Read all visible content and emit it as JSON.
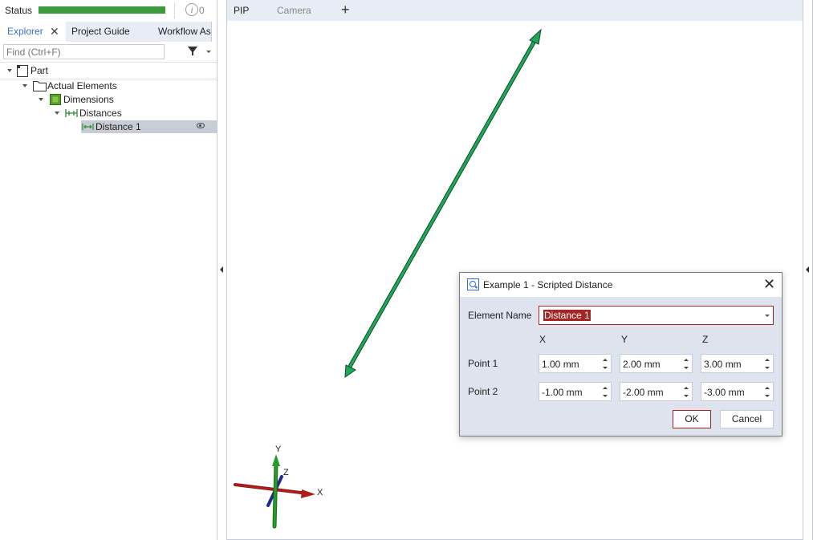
{
  "status": {
    "label": "Status",
    "progress_percent": 100,
    "progress_color": "#3c9a3c",
    "info_icon": "info-circle-icon",
    "info_count": "0"
  },
  "left_tabs": [
    {
      "label": "Explorer",
      "active": true,
      "closable": true
    },
    {
      "label": "Project Guide",
      "active": false
    },
    {
      "label": "Workflow Assistant",
      "active": false
    }
  ],
  "search": {
    "placeholder": "Find (Ctrl+F)",
    "value": ""
  },
  "tree": [
    {
      "label": "Part",
      "level": 0,
      "expanded": true,
      "icon": "part-icon"
    },
    {
      "label": "Actual Elements",
      "level": 1,
      "expanded": true,
      "icon": "folder-icon"
    },
    {
      "label": "Dimensions",
      "level": 2,
      "expanded": true,
      "icon": "dimensions-icon"
    },
    {
      "label": "Distances",
      "level": 3,
      "expanded": true,
      "icon": "distances-icon"
    },
    {
      "label": "Distance 1",
      "level": 4,
      "selected": true,
      "icon": "distance-icon",
      "visible": true
    }
  ],
  "viewport": {
    "tabs": [
      {
        "label": "PIP",
        "active": true
      },
      {
        "label": "Camera",
        "active": false
      },
      {
        "label": "+"
      }
    ],
    "axes": {
      "x_label": "X",
      "y_label": "Y",
      "z_label": "Z",
      "x_color": "#b01e1e",
      "y_color": "#2a9a2a",
      "z_color": "#1e2a8a"
    },
    "distance_arrow_color": "#1fa85a"
  },
  "dialog": {
    "title": "Example 1 - Scripted Distance",
    "element_name_label": "Element Name",
    "element_name_value": "Distance 1",
    "columns": [
      "X",
      "Y",
      "Z"
    ],
    "rows": [
      {
        "label": "Point 1",
        "values": [
          "1.00 mm",
          "2.00 mm",
          "3.00 mm"
        ]
      },
      {
        "label": "Point 2",
        "values": [
          "-1.00 mm",
          "-2.00 mm",
          "-3.00 mm"
        ]
      }
    ],
    "ok_label": "OK",
    "cancel_label": "Cancel",
    "accent_color": "#a52525"
  }
}
